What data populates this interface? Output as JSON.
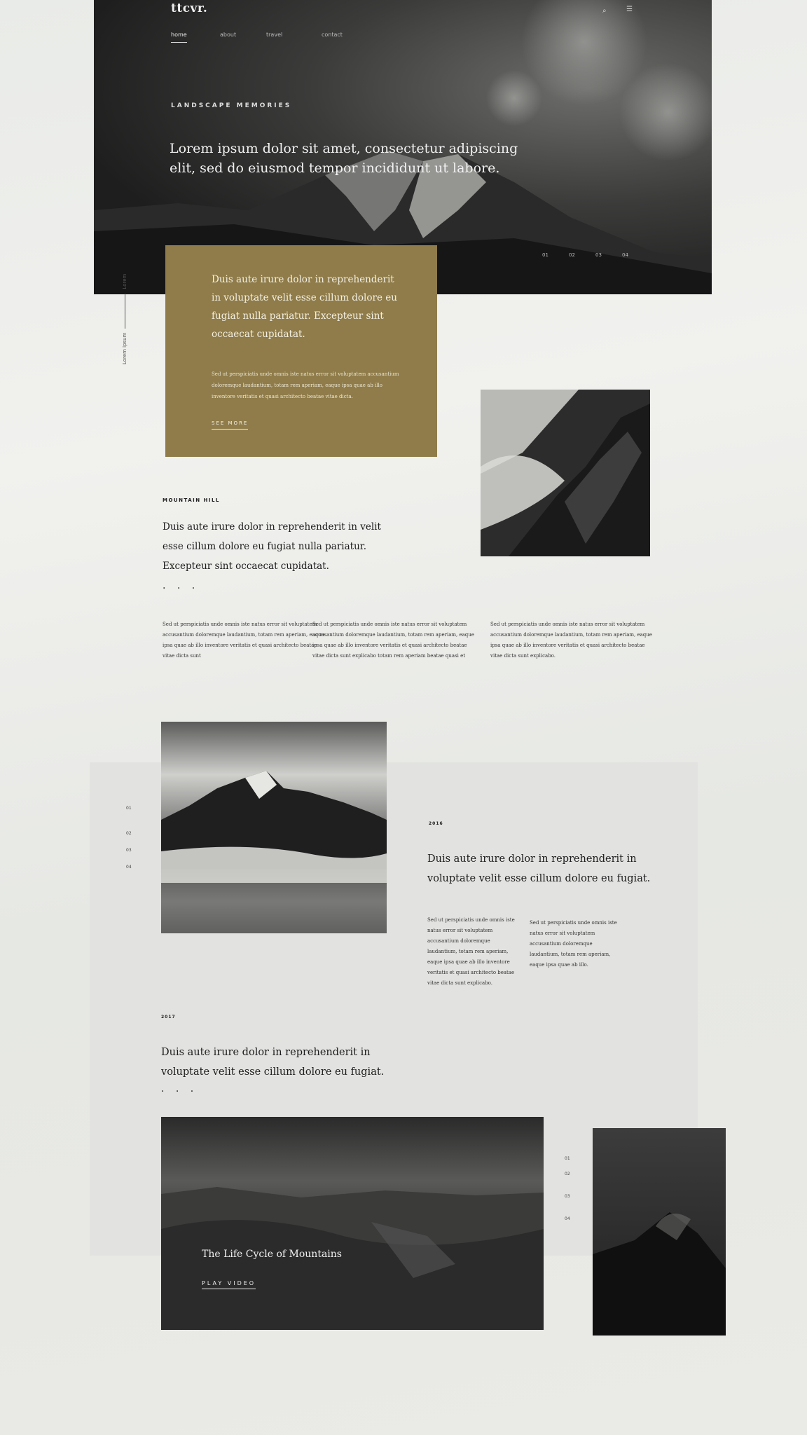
{
  "header": {
    "logo": "ttcvr.",
    "nav": [
      {
        "label": "home"
      },
      {
        "label": "about"
      },
      {
        "label": "travel"
      },
      {
        "label": "contact"
      }
    ]
  },
  "hero": {
    "kicker": "LANDSCAPE MEMORIES",
    "headline": "Lorem ipsum dolor sit amet, consectetur adipiscing elit, sed do eiusmod tempor incididunt ut labore.",
    "pager": [
      "01",
      "02",
      "03",
      "04"
    ]
  },
  "intro_card": {
    "lead": "Duis aute irure dolor in reprehenderit in voluptate velit esse cillum dolore eu fugiat nulla pariatur. Excepteur sint occaecat cupidatat.",
    "body": "Sed ut perspiciatis unde omnis iste natus error sit voluptatem accusantium doloremque laudantium, totam rem aperiam, eaque ipsa quae ab illo inventore veritatis et quasi architecto beatae vitae dicta.",
    "link": "SEE MORE"
  },
  "side_label": {
    "left": "Lorem ipsum",
    "right": "Lorem"
  },
  "mountain_hill": {
    "tag": "MOUNTAIN HILL",
    "headline": "Duis aute irure dolor in reprehenderit in velit esse cillum dolore eu fugiat nulla pariatur. Excepteur sint occaecat cupidatat.",
    "dots": "· · ·",
    "columns": [
      "Sed ut perspiciatis unde omnis iste natus error sit voluptatem accusantium doloremque laudantium, totam rem aperiam, eaque ipsa quae ab illo inventore veritatis et quasi architecto beatae vitae dicta sunt",
      "Sed ut perspiciatis unde omnis iste natus error sit voluptatem accusantium doloremque laudantium, totam rem aperiam, eaque ipsa quae ab illo inventore veritatis et quasi architecto beatae vitae dicta sunt explicabo totam rem aperiam beatae quasi et",
      "Sed ut perspiciatis unde omnis iste natus error sit voluptatem accusantium doloremque laudantium, totam rem aperiam, eaque ipsa quae ab illo inventore veritatis et quasi architecto beatae vitae dicta sunt explicabo."
    ]
  },
  "feature_2016": {
    "year": "2016",
    "headline": "Duis aute irure dolor in reprehenderit in voluptate velit esse cillum dolore eu fugiat.",
    "columns": [
      "Sed ut perspiciatis unde omnis iste natus error sit voluptatem accusantium doloremque laudantium, totam rem aperiam, eaque ipsa quae ab illo inventore veritatis et quasi architecto beatae vitae dicta sunt explicabo.",
      "Sed ut perspiciatis unde omnis iste natus error sit voluptatem accusantium doloremque laudantium, totam rem aperiam, eaque ipsa quae ab illo."
    ],
    "pager": [
      "01",
      "02",
      "03",
      "04"
    ]
  },
  "feature_2017": {
    "year": "2017",
    "headline": "Duis aute irure dolor in reprehenderit in voluptate velit esse cillum dolore eu fugiat.",
    "dots": "· · ·"
  },
  "video": {
    "title": "The Life Cycle of Mountains",
    "play": "PLAY VIDEO",
    "pager": [
      "01",
      "02",
      "03",
      "04"
    ]
  }
}
